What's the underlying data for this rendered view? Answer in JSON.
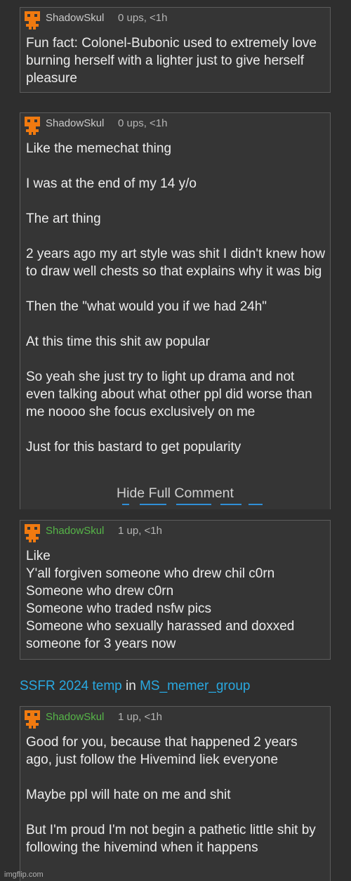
{
  "comments": [
    {
      "username": "ShadowSkul",
      "meta": "0 ups, <1h",
      "avatar_icon": "orange-skull-icon",
      "text": "Fun fact: Colonel-Bubonic used to extremely love burning herself with a lighter just to give herself pleasure"
    },
    {
      "username": "ShadowSkul",
      "meta": "0 ups, <1h",
      "avatar_icon": "orange-skull-icon",
      "text": "Like the memechat thing\n\nI was at the end of my 14 y/o\n\nThe art thing\n\n2 years ago my art style was shit I didn't knew how to draw well chests so that explains why it was big\n\nThen the \"what would you if we had 24h\"\n\nAt this time this shit aw popular\n\nSo yeah she just try to light up drama and not even talking about what other ppl did worse than me noooo she focus exclusively on me\n\nJust for this bastard to get popularity",
      "toggle_label": "Hide Full Comment"
    },
    {
      "username": "ShadowSkul",
      "meta": "1 up, <1h",
      "avatar_icon": "orange-skull-icon",
      "text": "Like\nY'all forgiven someone who drew chil c0rn\nSomeone who drew c0rn\nSomeone who traded nsfw pics\nSomeone who sexually harassed and doxxed someone for 3 years now"
    },
    {
      "username": "ShadowSkul",
      "meta": "1 up, <1h",
      "avatar_icon": "orange-skull-icon",
      "text": "Good for you, because that happened 2 years ago, just follow the Hivemind liek everyone\n\nMaybe ppl will hate on me and shit\n\nBut I'm proud I'm not begin a pathetic little shit by following the hivemind when it happens"
    }
  ],
  "context": {
    "post_title": "SSFR 2024 temp",
    "in_word": "in",
    "stream": "MS_memer_group"
  },
  "watermark": "imgflip.com",
  "colors": {
    "background": "#2e2e2e",
    "card": "#353535",
    "link": "#29a8e0",
    "username_green": "#56b548",
    "avatar_orange": "#f07a10"
  }
}
